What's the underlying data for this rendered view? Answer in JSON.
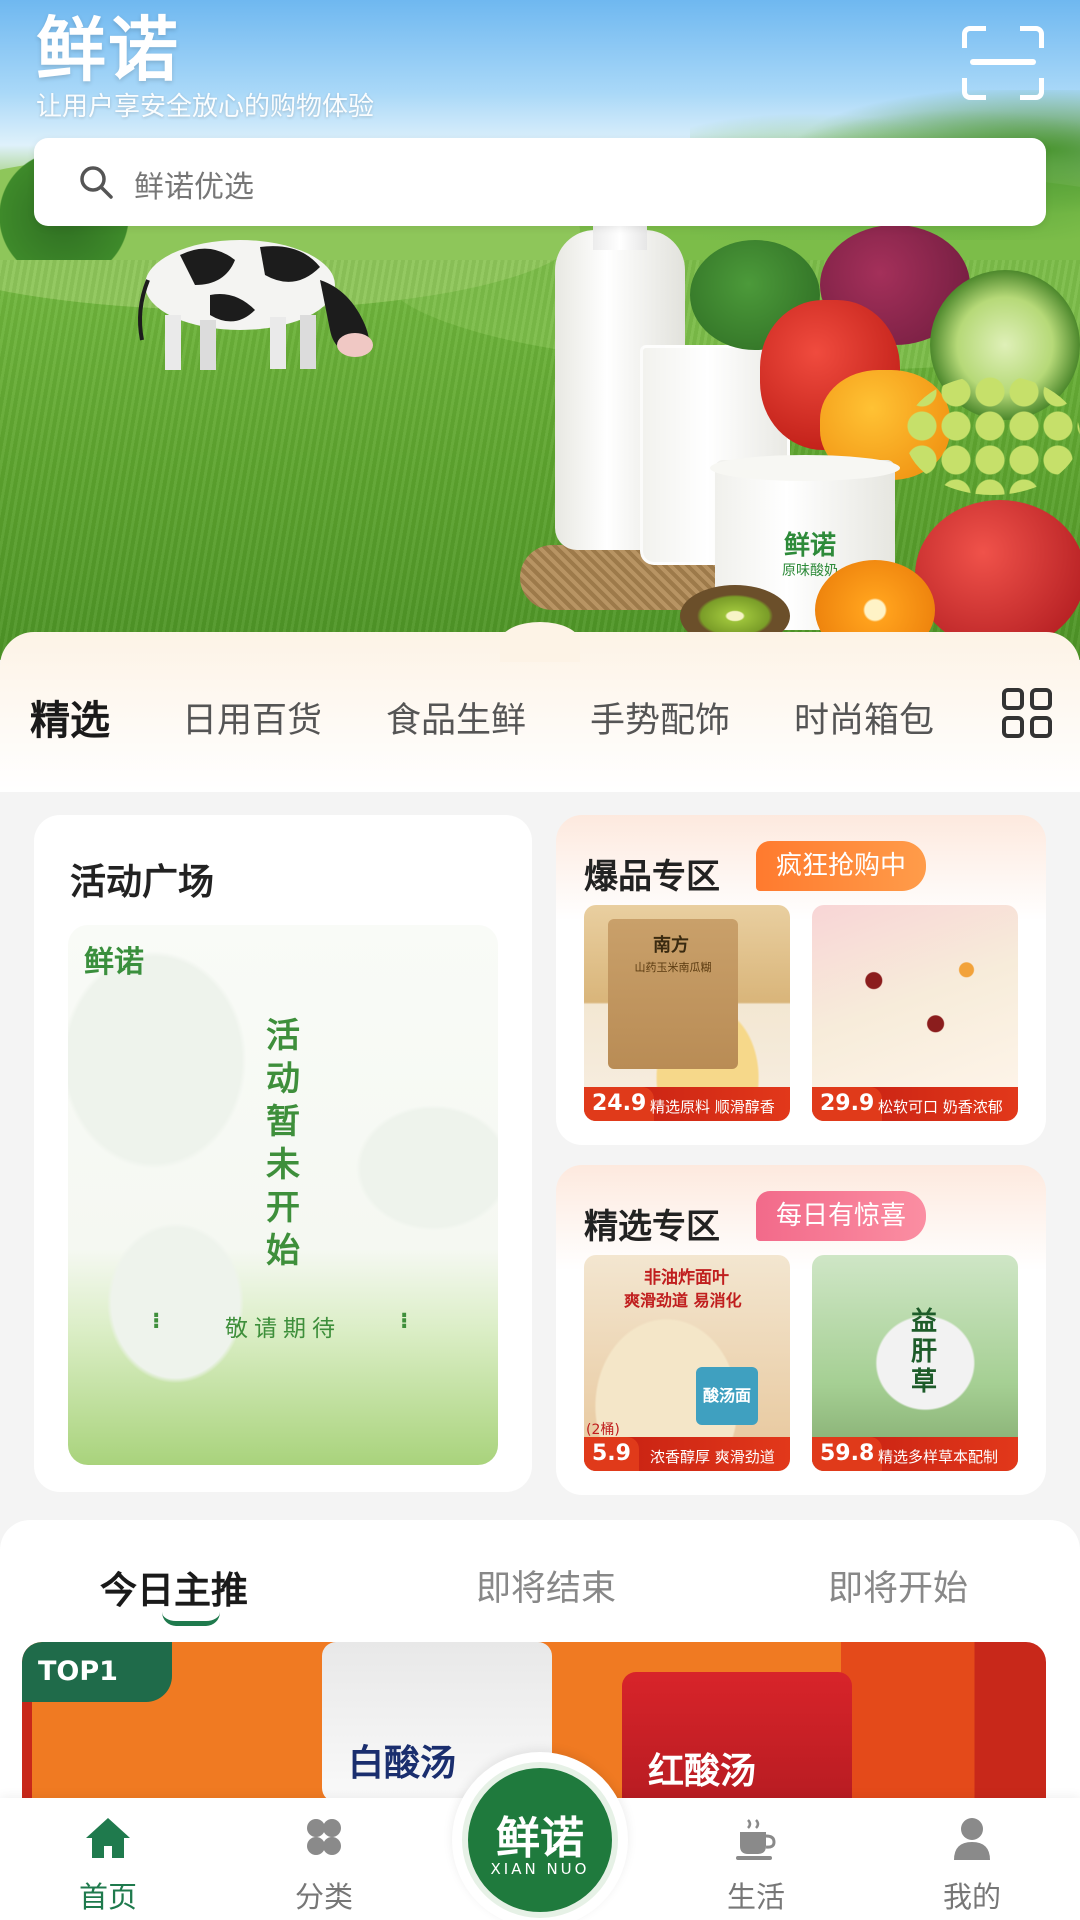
{
  "header": {
    "logo_text": "鲜诺",
    "slogan": "让用户享安全放心的购物体验",
    "scan_icon": "scan-icon"
  },
  "search": {
    "placeholder": "鲜诺优选",
    "icon": "search-icon"
  },
  "hero_product": {
    "brand": "鲜诺",
    "sub": "原味酸奶"
  },
  "categories": {
    "items": [
      "精选",
      "日用百货",
      "食品生鲜",
      "手势配饰",
      "时尚箱包"
    ],
    "active_index": 0,
    "more_icon": "grid-icon"
  },
  "activity": {
    "title": "活动广场",
    "banner_logo": "鲜诺",
    "vertical_text": [
      "活",
      "动",
      "暂",
      "未",
      "开",
      "始"
    ],
    "subtitle": "敬请期待"
  },
  "hot_zone": {
    "title": "爆品专区",
    "badge": "疯狂抢购中",
    "products": [
      {
        "price": "24.9",
        "tag": "精选原料 顺滑醇香",
        "package_brand": "南方",
        "package_name": "山药玉米南瓜糊"
      },
      {
        "price": "29.9",
        "tag": "松软可口 奶香浓郁"
      }
    ]
  },
  "select_zone": {
    "title": "精选专区",
    "badge": "每日有惊喜",
    "products": [
      {
        "price": "5.9",
        "unit": "(2桶)",
        "tag": "浓香醇厚 爽滑劲道",
        "headline": "非油炸面叶",
        "subline": "爽滑劲道 易消化",
        "package_name": "酸汤面叶"
      },
      {
        "price": "59.8",
        "tag": "精选多样草本配制",
        "can_text": "益肝草"
      }
    ]
  },
  "today": {
    "tabs": [
      "今日主推",
      "即将结束",
      "即将开始"
    ],
    "active_index": 0,
    "top_badge": "TOP1",
    "pouch1_text": "白酸汤",
    "pouch2_text": "红酸汤"
  },
  "bottom_nav": {
    "items": [
      {
        "label": "首页",
        "icon": "home-icon"
      },
      {
        "label": "分类",
        "icon": "category-icon"
      },
      {
        "label": "生活",
        "icon": "coffee-icon"
      },
      {
        "label": "我的",
        "icon": "user-icon"
      }
    ],
    "active_index": 0,
    "center_logo": "鲜诺",
    "center_sub": "XIAN NUO"
  },
  "colors": {
    "brand_green": "#1f7a3d",
    "accent_orange": "#ff7a2e",
    "accent_pink": "#f26a8a",
    "price_red": "#e03a1a"
  }
}
